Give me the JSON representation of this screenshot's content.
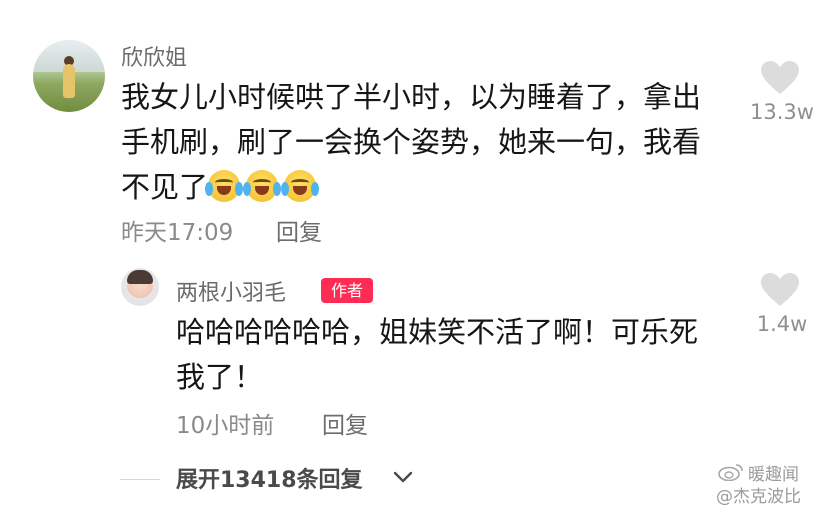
{
  "comment": {
    "username": "欣欣姐",
    "text_lines": [
      "我女儿小时候哄了半小时，以为睡着了，拿出",
      "手机刷，刷了一会换个姿势，她来一句，我看",
      "不见了"
    ],
    "emojis": [
      "laugh-cry-icon",
      "laugh-cry-icon",
      "laugh-cry-icon"
    ],
    "time": "昨天17:09",
    "reply_label": "回复",
    "likes": "13.3w"
  },
  "reply": {
    "username": "两根小羽毛",
    "badge": "作者",
    "text_lines": [
      "哈哈哈哈哈哈，姐妹笑不活了啊！可乐死",
      "我了！"
    ],
    "time": "10小时前",
    "reply_label": "回复",
    "likes": "1.4w"
  },
  "expand_label": "展开13418条回复",
  "watermark": {
    "line1": "暖趣闻",
    "line2": "@杰克波比"
  },
  "colors": {
    "badge": "#fe2c55",
    "heart": "#dcdcdc"
  }
}
